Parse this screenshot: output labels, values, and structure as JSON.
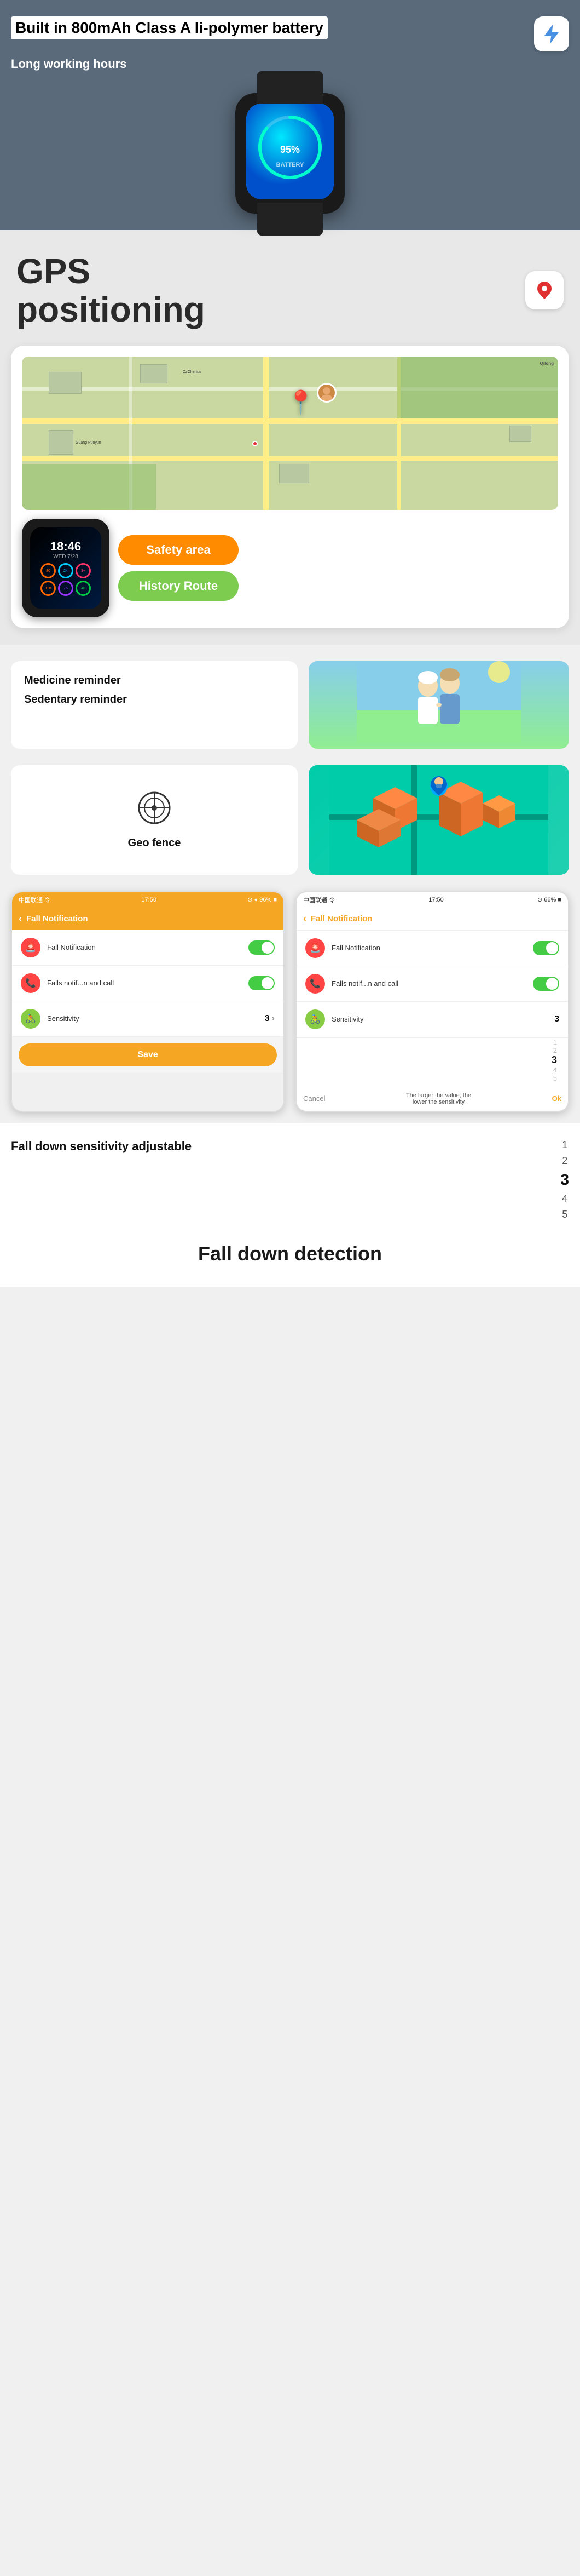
{
  "battery": {
    "title": "Built in 800mAh Class A li-polymer battery",
    "subtitle": "Long working hours",
    "icon": "⚡"
  },
  "gps": {
    "title_line1": "GPS",
    "title_line2": "positioning",
    "icon": "📍"
  },
  "map": {
    "safety_btn": "Safety area",
    "history_btn": "History Route",
    "watch_time": "18:46",
    "watch_date": "WED 7/28"
  },
  "medicine": {
    "item1": "Medicine reminder",
    "item2": "Sedentary reminder"
  },
  "geo": {
    "label": "Geo fence"
  },
  "fall_notification": {
    "title": "Fall Notification",
    "row1_label": "Fall Notification",
    "row2_label": "Falls notif...n and call",
    "row3_label": "Sensitivity",
    "sensitivity_value": "3",
    "save_label": "Save",
    "status_left": "中国联通 令",
    "status_time": "17:50",
    "status_right": "⊙ ● 96% ■",
    "status_right2": "⊙ 66% ■",
    "cancel_label": "Cancel",
    "ok_label": "Ok",
    "popup_note": "The larger the value, the lower the sensitivity"
  },
  "sensitivity": {
    "title": "Fall down sensitivity adjustable",
    "numbers": [
      "1",
      "2",
      "3",
      "4",
      "5"
    ],
    "active_number": "3"
  },
  "fall_detection": {
    "title": "Fall down detection"
  }
}
